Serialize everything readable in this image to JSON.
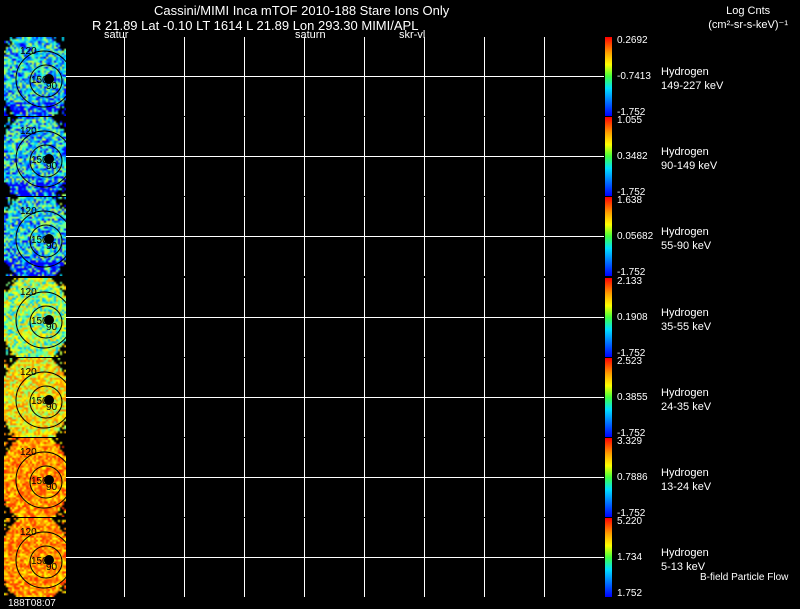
{
  "header": {
    "title": "Cassini/MIMI Inca mTOF  2010-188   Stare    Ions Only",
    "line2": "R       21.89 Lat -0.10 LT 1614 L          21.89 Lon          293.30  MIMI/APL",
    "label_a": "satur",
    "label_b": "saturn",
    "label_c": "skr-vl",
    "units_line1": "Log Cnts",
    "units_line2": "(cm²-sr-s-keV)⁻¹"
  },
  "footer": {
    "timestamp": "188T08:07",
    "bfield_note": "B-field Particle Flow"
  },
  "panels": [
    {
      "species": "Hydrogen",
      "energy": "149-227 keV",
      "cmax": "0.2692",
      "cmid": "-0.7413",
      "cmin": "-1.752",
      "lbl_upper": "120",
      "lbl_lower": "150",
      "lbl_dot": "90"
    },
    {
      "species": "Hydrogen",
      "energy": "90-149 keV",
      "cmax": "1.055",
      "cmid": "0.3482",
      "cmin": "-1.752",
      "lbl_upper": "120",
      "lbl_lower": "150",
      "lbl_dot": "90"
    },
    {
      "species": "Hydrogen",
      "energy": "55-90 keV",
      "cmax": "1.638",
      "cmid": "0.05682",
      "cmin": "-1.752",
      "lbl_upper": "120",
      "lbl_lower": "150",
      "lbl_dot": "90"
    },
    {
      "species": "Hydrogen",
      "energy": "35-55 keV",
      "cmax": "2.133",
      "cmid": "0.1908",
      "cmin": "-1.752",
      "lbl_upper": "120",
      "lbl_lower": "150",
      "lbl_dot": "90"
    },
    {
      "species": "Hydrogen",
      "energy": "24-35 keV",
      "cmax": "2.523",
      "cmid": "0.3855",
      "cmin": "-1.752",
      "lbl_upper": "120",
      "lbl_lower": "150",
      "lbl_dot": "90"
    },
    {
      "species": "Hydrogen",
      "energy": "13-24 keV",
      "cmax": "3.329",
      "cmid": "0.7886",
      "cmin": "-1.752",
      "lbl_upper": "120",
      "lbl_lower": "150",
      "lbl_dot": "90"
    },
    {
      "species": "Hydrogen",
      "energy": "5-13 keV",
      "cmax": "5.220",
      "cmid": "1.734",
      "cmin": "1.752",
      "lbl_upper": "120",
      "lbl_lower": "150",
      "lbl_dot": "90"
    }
  ],
  "palettes": [
    "cool",
    "cool",
    "cool",
    "mid",
    "warm",
    "hot",
    "hot"
  ]
}
